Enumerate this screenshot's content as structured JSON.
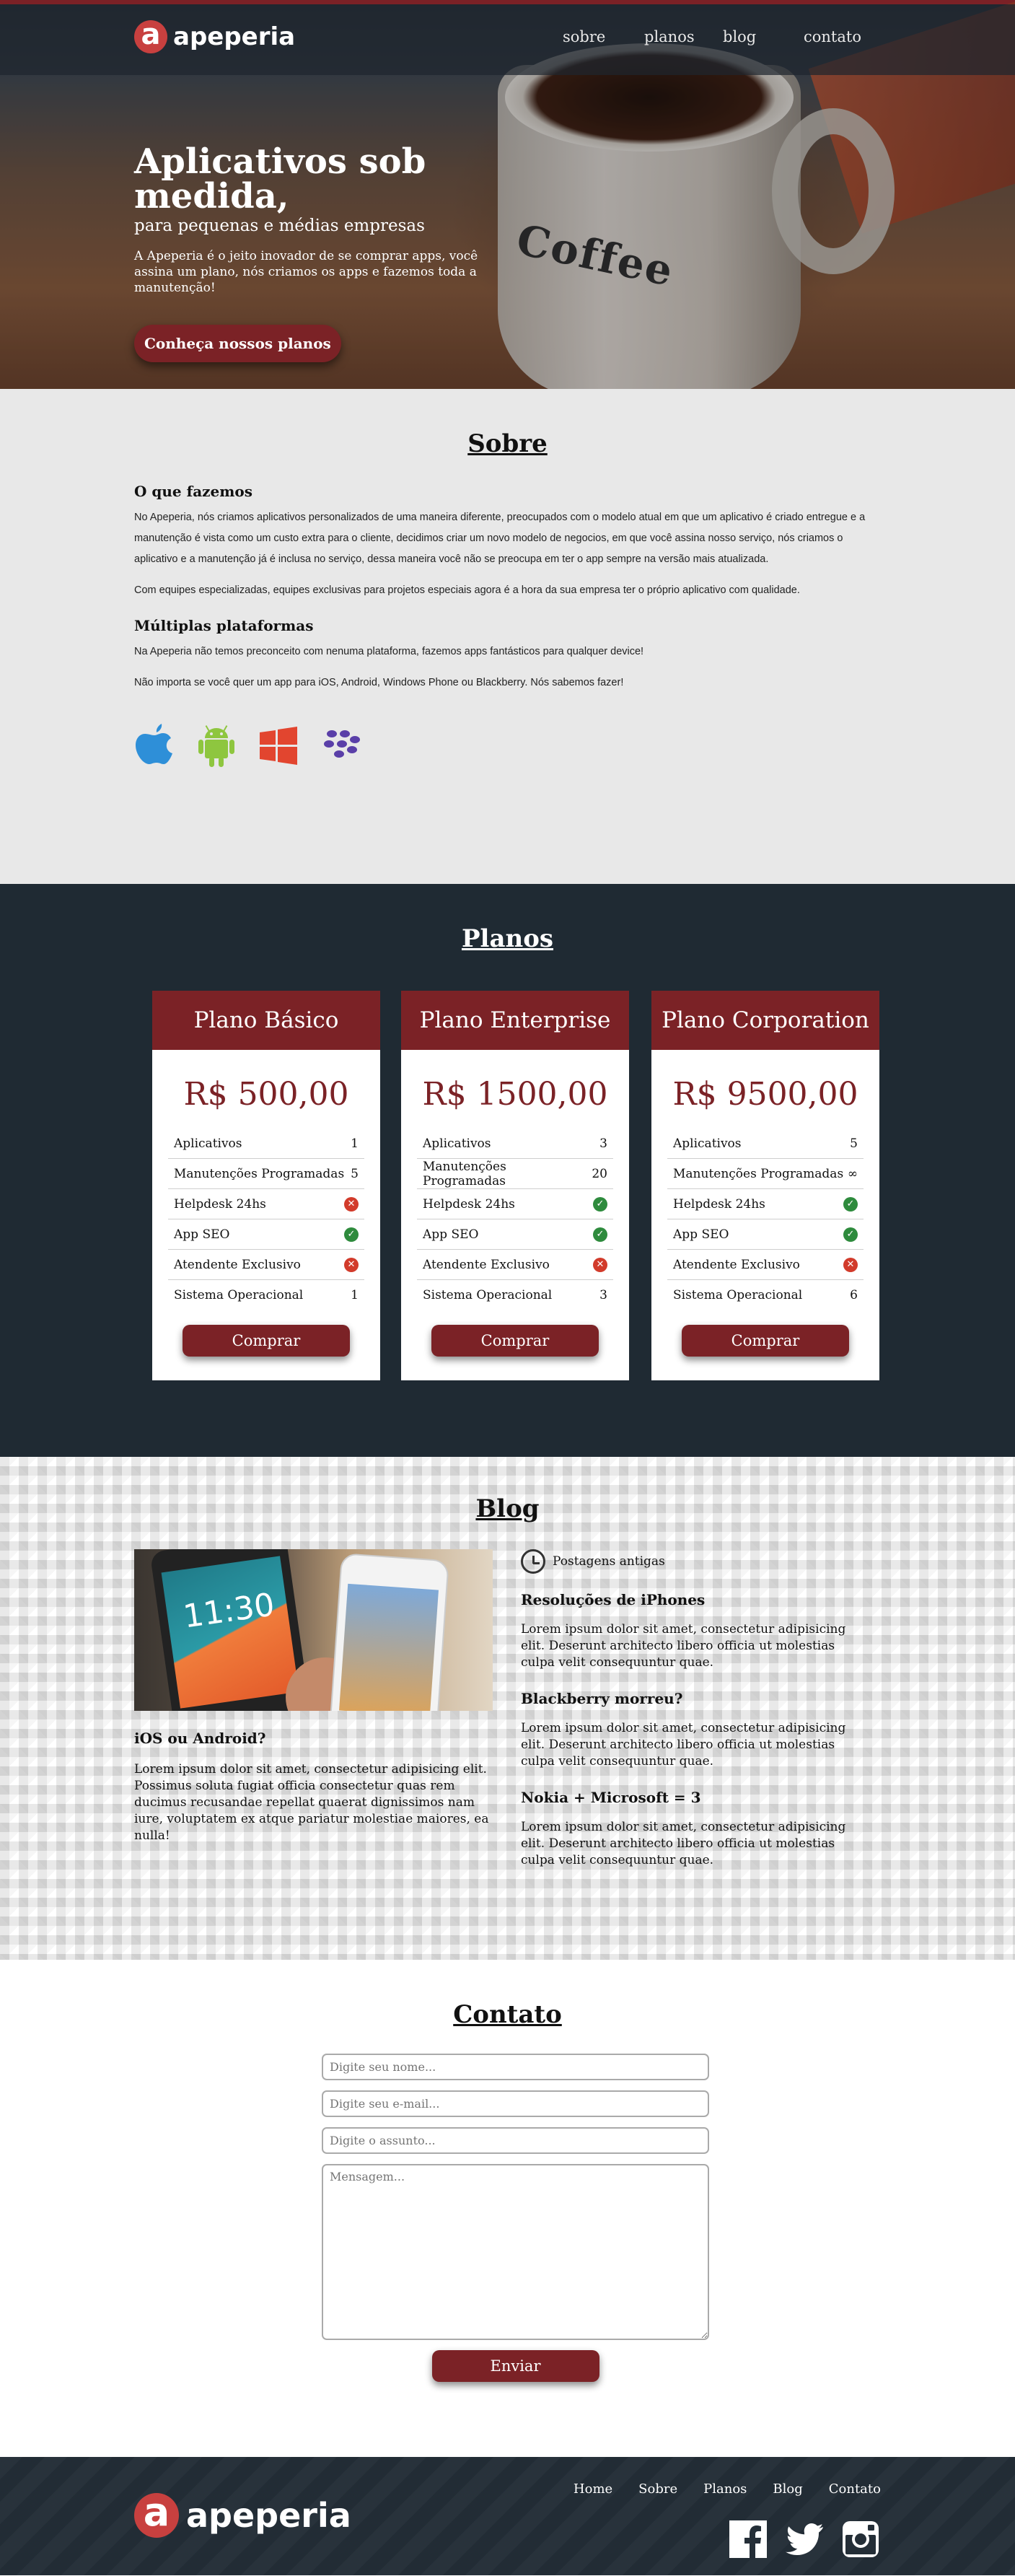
{
  "brand": {
    "name": "apeperia",
    "mark": "a"
  },
  "nav": {
    "items": [
      "sobre",
      "planos",
      "blog",
      "contato"
    ]
  },
  "hero": {
    "title": "Aplicativos sob medida,",
    "subtitle": "para pequenas e médias empresas",
    "description": "A Apeperia é o jeito inovador de se comprar apps, você assina um plano, nós criamos os apps e fazemos toda a manutenção!",
    "cta": "Conheça nossos planos",
    "mug_text": "Coffee"
  },
  "sobre": {
    "title": "Sobre",
    "h1": "O que fazemos",
    "p1": "No Apeperia, nós criamos aplicativos personalizados de uma maneira diferente, preocupados com o modelo atual em que um aplicativo é criado entregue e a manutenção é vista como um custo extra para o cliente, decidimos criar um novo modelo de negocios, em que você assina nosso serviço, nós criamos o aplicativo e a manutenção já é inclusa no serviço, dessa maneira você não se preocupa em ter o app sempre na versão mais atualizada.",
    "p2": "Com equipes especializadas, equipes exclusivas para projetos especiais agora é a hora da sua empresa ter o próprio aplicativo com qualidade.",
    "h2": "Múltiplas plataformas",
    "p3": "Na Apeperia não temos preconceito com nenuma plataforma, fazemos apps fantásticos para qualquer device!",
    "p4": "Não importa se você quer um app para iOS, Android, Windows Phone ou Blackberry. Nós sabemos fazer!",
    "platform_icons": [
      "apple-icon",
      "android-icon",
      "windows-icon",
      "blackberry-icon"
    ],
    "platform_colors": {
      "apple": "#2e8fd8",
      "android": "#8ec63f",
      "windows": "#e2452f",
      "blackberry": "#5a3fa8"
    }
  },
  "planos": {
    "title": "Planos",
    "buy_label": "Comprar",
    "plans": [
      {
        "name": "Plano Básico",
        "price": "R$ 500,00",
        "features": [
          {
            "label": "Aplicativos",
            "value": "1"
          },
          {
            "label": "Manutenções Programadas",
            "value": "5"
          },
          {
            "label": "Helpdesk 24hs",
            "value": "no"
          },
          {
            "label": "App SEO",
            "value": "yes"
          },
          {
            "label": "Atendente Exclusivo",
            "value": "no"
          },
          {
            "label": "Sistema Operacional",
            "value": "1"
          }
        ]
      },
      {
        "name": "Plano Enterprise",
        "price": "R$ 1500,00",
        "features": [
          {
            "label": "Aplicativos",
            "value": "3"
          },
          {
            "label": "Manutenções Programadas",
            "value": "20"
          },
          {
            "label": "Helpdesk 24hs",
            "value": "yes"
          },
          {
            "label": "App SEO",
            "value": "yes"
          },
          {
            "label": "Atendente Exclusivo",
            "value": "no"
          },
          {
            "label": "Sistema Operacional",
            "value": "3"
          }
        ]
      },
      {
        "name": "Plano Corporation",
        "price": "R$ 9500,00",
        "features": [
          {
            "label": "Aplicativos",
            "value": "5"
          },
          {
            "label": "Manutenções Programadas",
            "value": "∞"
          },
          {
            "label": "Helpdesk 24hs",
            "value": "yes"
          },
          {
            "label": "App SEO",
            "value": "yes"
          },
          {
            "label": "Atendente Exclusivo",
            "value": "no"
          },
          {
            "label": "Sistema Operacional",
            "value": "6"
          }
        ]
      }
    ]
  },
  "blog": {
    "title": "Blog",
    "phone_clock": "11:30",
    "featured": {
      "title": "iOS ou Android?",
      "body": "Lorem ipsum dolor sit amet, consectetur adipisicing elit. Possimus soluta fugiat officia consectetur quas rem ducimus recusandae repellat quaerat dignissimos nam iure, voluptatem ex atque pariatur molestiae maiores, ea nulla!"
    },
    "older_label": "Postagens antigas",
    "posts": [
      {
        "title": "Resoluções de iPhones",
        "body": "Lorem ipsum dolor sit amet, consectetur adipisicing elit. Deserunt architecto libero officia ut molestias culpa velit consequuntur quae."
      },
      {
        "title": "Blackberry morreu?",
        "body": "Lorem ipsum dolor sit amet, consectetur adipisicing elit. Deserunt architecto libero officia ut molestias culpa velit consequuntur quae."
      },
      {
        "title": "Nokia + Microsoft = 3",
        "body": "Lorem ipsum dolor sit amet, consectetur adipisicing elit. Deserunt architecto libero officia ut molestias culpa velit consequuntur quae."
      }
    ]
  },
  "contato": {
    "title": "Contato",
    "name_placeholder": "Digite seu nome...",
    "email_placeholder": "Digite seu e-mail...",
    "subject_placeholder": "Digite o assunto...",
    "message_placeholder": "Mensagem...",
    "send_label": "Enviar"
  },
  "footer": {
    "menu": [
      "Home",
      "Sobre",
      "Planos",
      "Blog",
      "Contato"
    ],
    "social_icons": [
      "facebook-icon",
      "twitter-icon",
      "instagram-icon"
    ]
  },
  "colors": {
    "accent": "#7b2226",
    "brand_red": "#c8403f",
    "dark": "#1f2a33",
    "ok": "#2e8b3d",
    "no": "#d23b2b"
  }
}
